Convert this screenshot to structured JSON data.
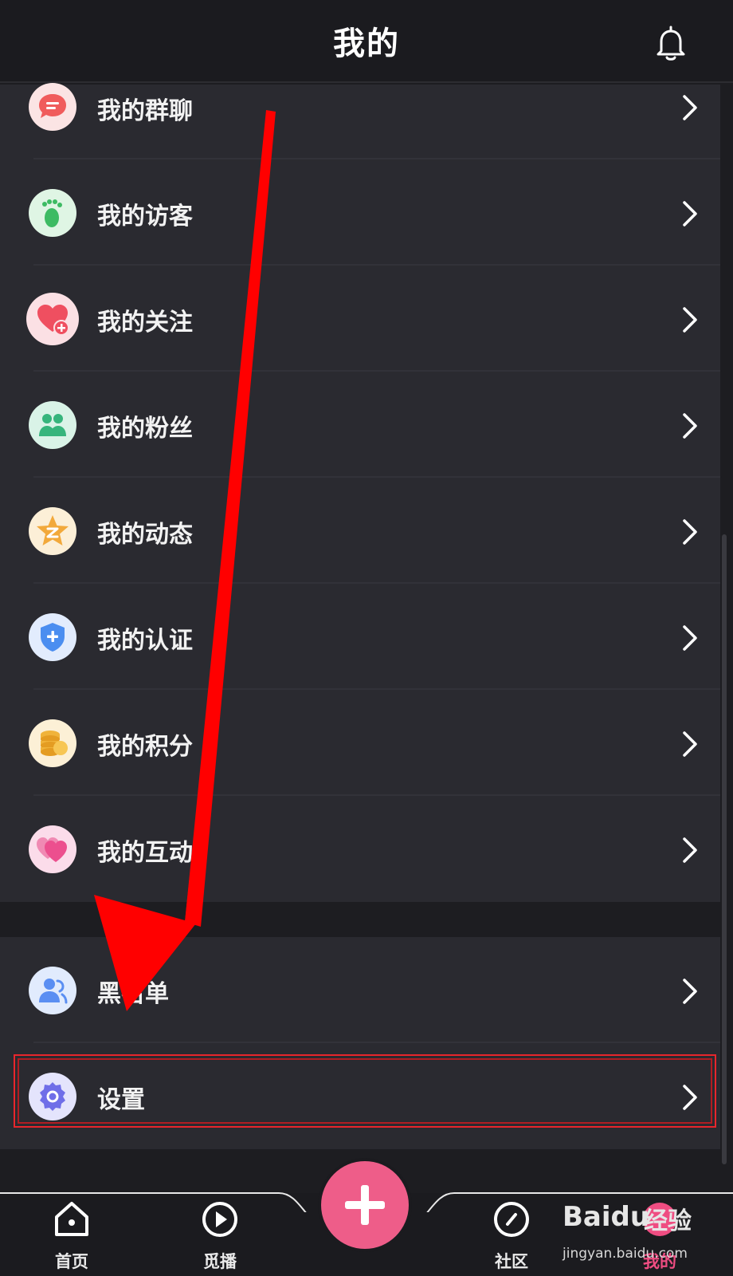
{
  "header": {
    "title": "我的",
    "bell_icon": "bell-icon"
  },
  "menu_group_1": [
    {
      "label": "我的群聊",
      "icon": "chat-bubble-icon",
      "color": "#f36b6b"
    },
    {
      "label": "我的访客",
      "icon": "footprint-icon",
      "color": "#4cc46d"
    },
    {
      "label": "我的关注",
      "icon": "heart-plus-icon",
      "color": "#f06070"
    },
    {
      "label": "我的粉丝",
      "icon": "people-icon",
      "color": "#3fbf87"
    },
    {
      "label": "我的动态",
      "icon": "star-z-icon",
      "color": "#f2a93b"
    },
    {
      "label": "我的认证",
      "icon": "shield-plus-icon",
      "color": "#4b8ef0"
    },
    {
      "label": "我的积分",
      "icon": "coins-icon",
      "color": "#f0b33a"
    },
    {
      "label": "我的互动",
      "icon": "double-heart-icon",
      "color": "#ee5d95"
    }
  ],
  "menu_group_2": [
    {
      "label": "黑名单",
      "icon": "user-block-icon",
      "color": "#5a8ef2"
    },
    {
      "label": "设置",
      "icon": "gear-icon",
      "color": "#6f6ee8"
    }
  ],
  "tabbar": {
    "tabs": [
      {
        "label": "首页",
        "icon": "home-icon",
        "active": false
      },
      {
        "label": "觅播",
        "icon": "play-icon",
        "active": false
      },
      {
        "label": "社区",
        "icon": "compass-icon",
        "active": false
      },
      {
        "label": "我的",
        "icon": "profile-icon",
        "active": true
      }
    ],
    "fab_icon": "plus-icon",
    "active_color": "#ef4d82"
  },
  "watermark": {
    "brand": "Baidu",
    "product": "经验",
    "url": "jingyan.baidu.com"
  },
  "annotation": {
    "arrow_color": "#ff0000",
    "highlight_color": "#e8262c"
  }
}
